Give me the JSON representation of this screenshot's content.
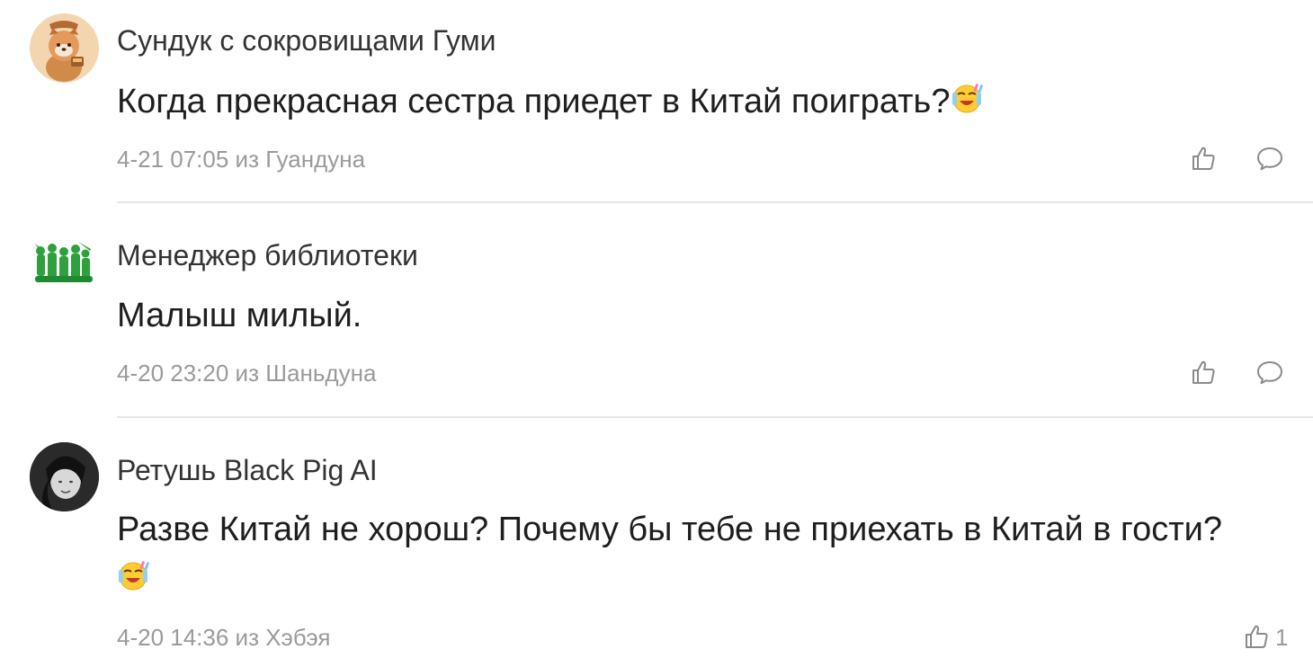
{
  "comments": [
    {
      "username": "Сундук с сокровищами Гуми",
      "text": "Когда прекрасная сестра приедет в Китай поиграть?",
      "emoji": "tearful-laugh-emoji",
      "meta": "4-21 07:05 из Гуандуна",
      "avatar": "red-panda-avatar",
      "like_count": ""
    },
    {
      "username": "Менеджер библиотеки",
      "text": "Малыш милый.",
      "meta": "4-20 23:20 из Шаньдуна",
      "avatar": "green-toy-soldiers-avatar",
      "like_count": ""
    },
    {
      "username": "Ретушь Black Pig AI",
      "text": "Разве Китай не хорош? Почему бы тебе не приехать в Китай в гости?",
      "emoji": "tearful-laugh-emoji",
      "meta": "4-20 14:36 из Хэбэя",
      "avatar": "bw-photo-avatar",
      "like_count": "1"
    }
  ],
  "icons": {
    "like": "thumbs-up-icon",
    "reply": "speech-bubble-icon"
  },
  "colors": {
    "meta_text": "#9a9a9a",
    "divider": "#e6e6e6",
    "avatar_bg_1": "#f3d6b0",
    "avatar_bg_3": "#3a3a3a"
  }
}
